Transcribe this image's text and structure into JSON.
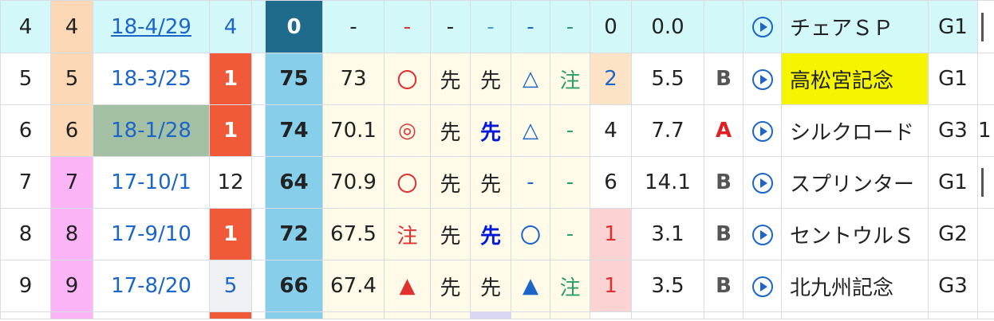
{
  "rows": [
    {
      "no": "4",
      "frame": "4",
      "date": "18-4/29",
      "pos": "4",
      "index": "0",
      "val": "-",
      "m1": "-",
      "m2": "-",
      "m3": "-",
      "m4": "-",
      "m5": "-",
      "rank": "0",
      "odds": "0.0",
      "grade": "",
      "race": "チェアＳＰ",
      "class": "G1",
      "extra": ""
    },
    {
      "no": "5",
      "frame": "5",
      "date": "18-3/25",
      "pos": "1",
      "index": "75",
      "val": "73",
      "m1": "〇",
      "m2": "先",
      "m3": "先",
      "m4": "△",
      "m5": "注",
      "rank": "2",
      "odds": "5.5",
      "grade": "B",
      "race": "高松宮記念",
      "class": "G1",
      "extra": ""
    },
    {
      "no": "6",
      "frame": "6",
      "date": "18-1/28",
      "pos": "1",
      "index": "74",
      "val": "70.1",
      "m1": "◎",
      "m2": "先",
      "m3": "先",
      "m4": "△",
      "m5": "-",
      "rank": "4",
      "odds": "7.7",
      "grade": "A",
      "race": "シルクロード",
      "class": "G3",
      "extra": "1"
    },
    {
      "no": "7",
      "frame": "7",
      "date": "17-10/1",
      "pos": "12",
      "index": "64",
      "val": "70.9",
      "m1": "〇",
      "m2": "先",
      "m3": "先",
      "m4": "-",
      "m5": "-",
      "rank": "6",
      "odds": "14.1",
      "grade": "B",
      "race": "スプリンター",
      "class": "G1",
      "extra": ""
    },
    {
      "no": "8",
      "frame": "8",
      "date": "17-9/10",
      "pos": "1",
      "index": "72",
      "val": "67.5",
      "m1": "注",
      "m2": "先",
      "m3": "先",
      "m4": "〇",
      "m5": "-",
      "rank": "1",
      "odds": "3.1",
      "grade": "B",
      "race": "セントウルＳ",
      "class": "G2",
      "extra": ""
    },
    {
      "no": "9",
      "frame": "9",
      "date": "17-8/20",
      "pos": "5",
      "index": "66",
      "val": "67.4",
      "m1": "▲",
      "m2": "先",
      "m3": "先",
      "m4": "▲",
      "m5": "注",
      "rank": "1",
      "odds": "3.5",
      "grade": "B",
      "race": "北九州記念",
      "class": "G3",
      "extra": ""
    }
  ],
  "icons": {
    "play": "play-circle-icon"
  },
  "colors": {
    "accent_blue": "#1c66c9",
    "win_orange": "#f05a38",
    "index_blue": "#87ceeb",
    "highlight_yellow": "#f5f500"
  }
}
